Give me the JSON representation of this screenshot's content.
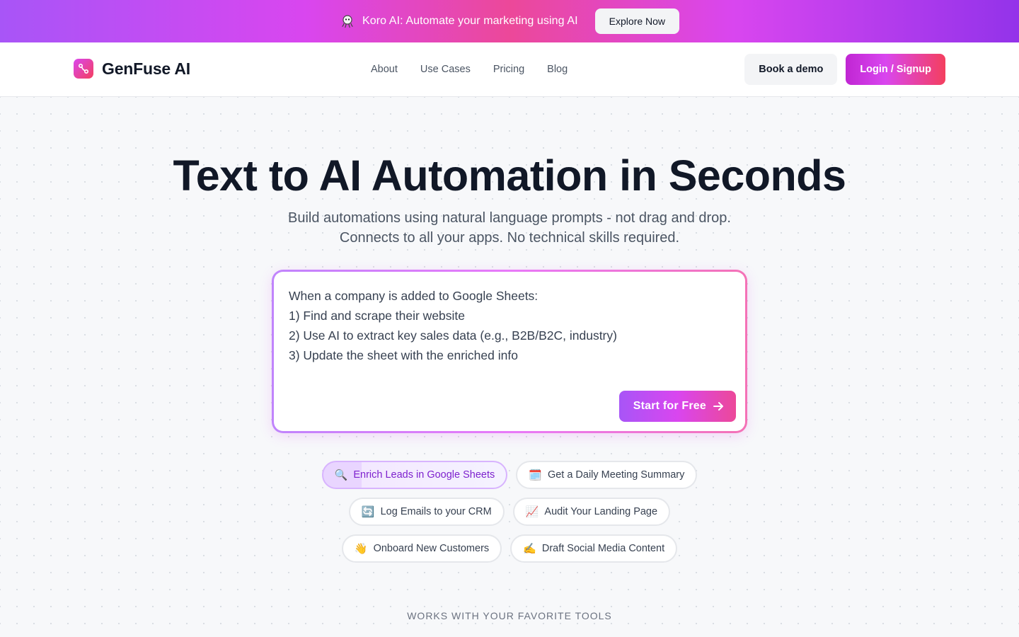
{
  "announcement": {
    "icon": "octopus-icon",
    "text": "Koro AI: Automate your marketing using AI",
    "button_label": "Explore Now"
  },
  "nav": {
    "brand_name": "GenFuse AI",
    "links": [
      "About",
      "Use Cases",
      "Pricing",
      "Blog"
    ],
    "book_demo_label": "Book a demo",
    "login_label": "Login / Signup"
  },
  "hero": {
    "title": "Text to AI Automation in Seconds",
    "subtitle_line1": "Build automations using natural language prompts - not drag and drop.",
    "subtitle_line2": "Connects to all your apps. No technical skills required.",
    "prompt_lines": [
      "When a company is added to Google Sheets:",
      "1) Find and scrape their website",
      "2) Use AI to extract key sales data (e.g., B2B/B2C, industry)",
      "3) Update the sheet with the enriched info"
    ],
    "start_button_label": "Start for Free",
    "chips": [
      {
        "emoji": "🔍",
        "label": "Enrich Leads in Google Sheets",
        "active": true
      },
      {
        "emoji": "🗓️",
        "label": "Get a Daily Meeting Summary",
        "active": false
      },
      {
        "emoji": "🔄",
        "label": "Log Emails to your CRM",
        "active": false
      },
      {
        "emoji": "📈",
        "label": "Audit Your Landing Page",
        "active": false
      },
      {
        "emoji": "👋",
        "label": "Onboard New Customers",
        "active": false
      },
      {
        "emoji": "✍️",
        "label": "Draft Social Media Content",
        "active": false
      }
    ],
    "works_with_label": "WORKS WITH YOUR FAVORITE TOOLS"
  },
  "colors": {
    "accent_purple": "#a855f7",
    "accent_pink": "#ec4899",
    "brand_gradient_start": "#d946ef",
    "brand_gradient_end": "#f43f5e",
    "text_dark": "#111827",
    "text_muted": "#4b5563"
  }
}
